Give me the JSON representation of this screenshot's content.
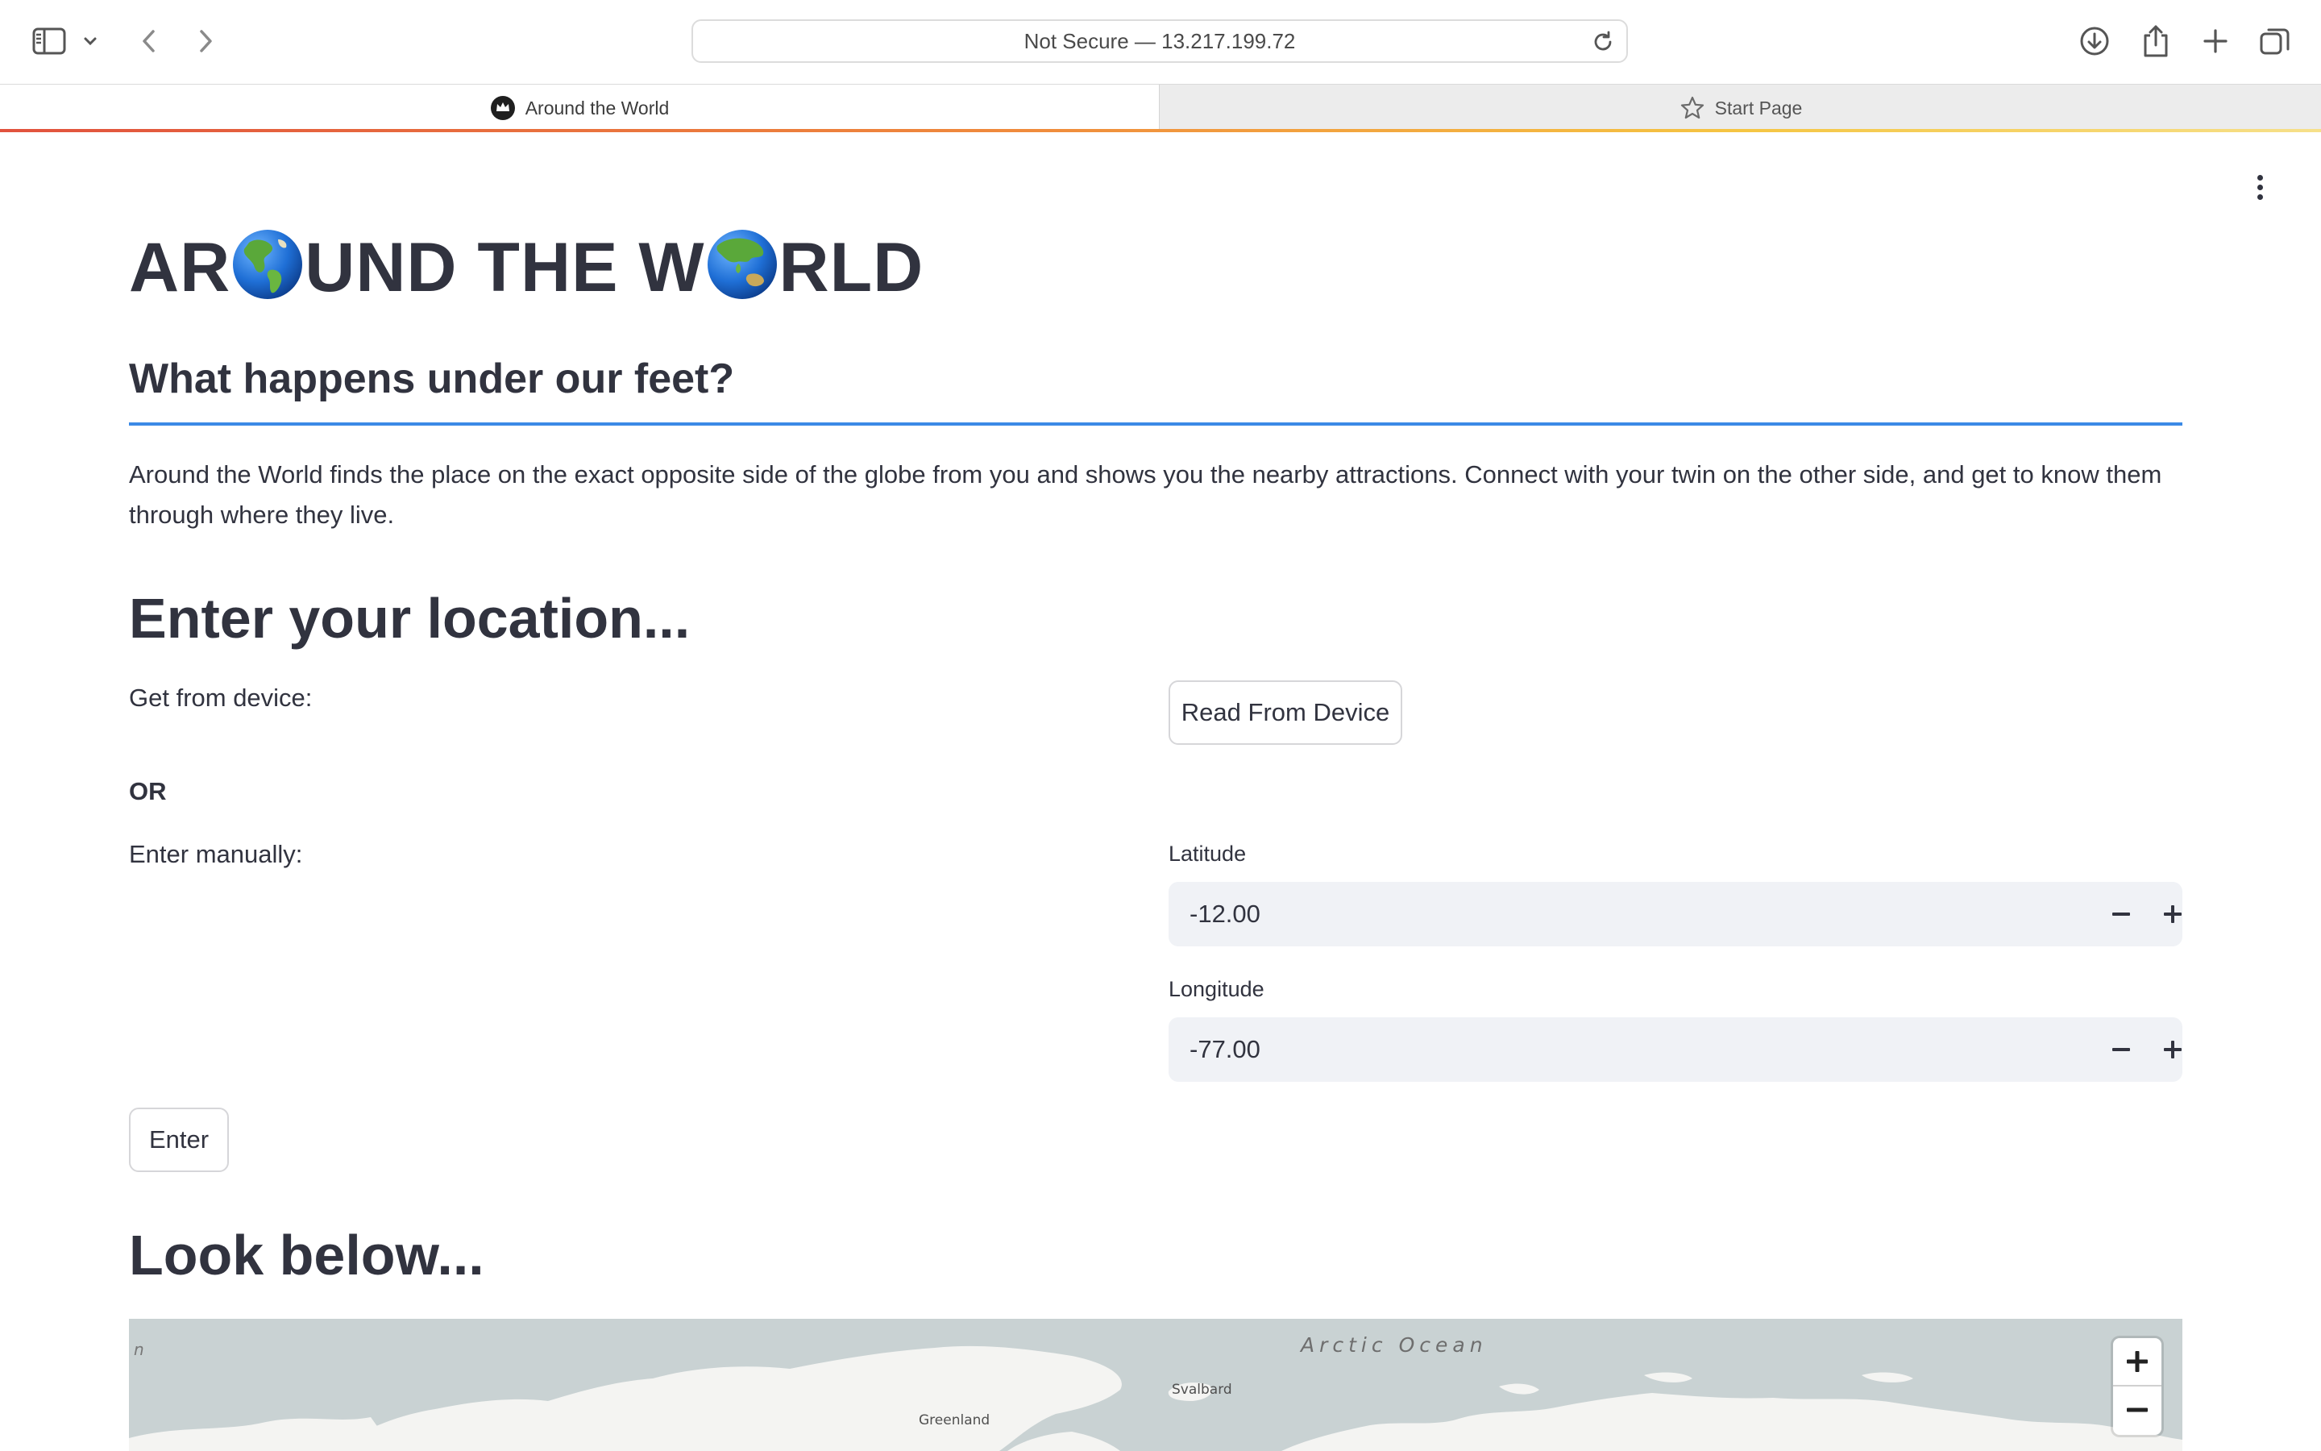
{
  "browser": {
    "url": "Not Secure — 13.217.199.72",
    "tabs": [
      {
        "label": "Around the World",
        "active": true,
        "icon": "streamlit-crown-icon"
      },
      {
        "label": "Start Page",
        "active": false,
        "icon": "star-icon"
      }
    ]
  },
  "page": {
    "title_parts": [
      "AR",
      "UND THE W",
      "RLD"
    ],
    "subtitle": "What happens under our feet?",
    "intro": "Around the World finds the place on the exact opposite side of the globe from you and shows you the nearby attractions. Connect with your twin on the other side, and get to know them through where they live.",
    "location_heading": "Enter your location...",
    "device_label": "Get from device:",
    "read_device_button": "Read From Device",
    "or_label": "OR",
    "manual_label": "Enter manually:",
    "latitude": {
      "label": "Latitude",
      "value": "-12.00"
    },
    "longitude": {
      "label": "Longitude",
      "value": "-77.00"
    },
    "enter_button": "Enter",
    "look_heading": "Look below..."
  },
  "map": {
    "labels": {
      "ocean": "Arctic Ocean",
      "svalbard": "Svalbard",
      "greenland": "Greenland",
      "edge": "n"
    },
    "zoom_in": "+",
    "zoom_out": "−"
  },
  "colors": {
    "accent_rule": "#3b8ae6",
    "input_bg": "#f0f2f6",
    "text": "#31333f",
    "ocean": "#c9d2d3",
    "land": "#f4f4f2"
  }
}
